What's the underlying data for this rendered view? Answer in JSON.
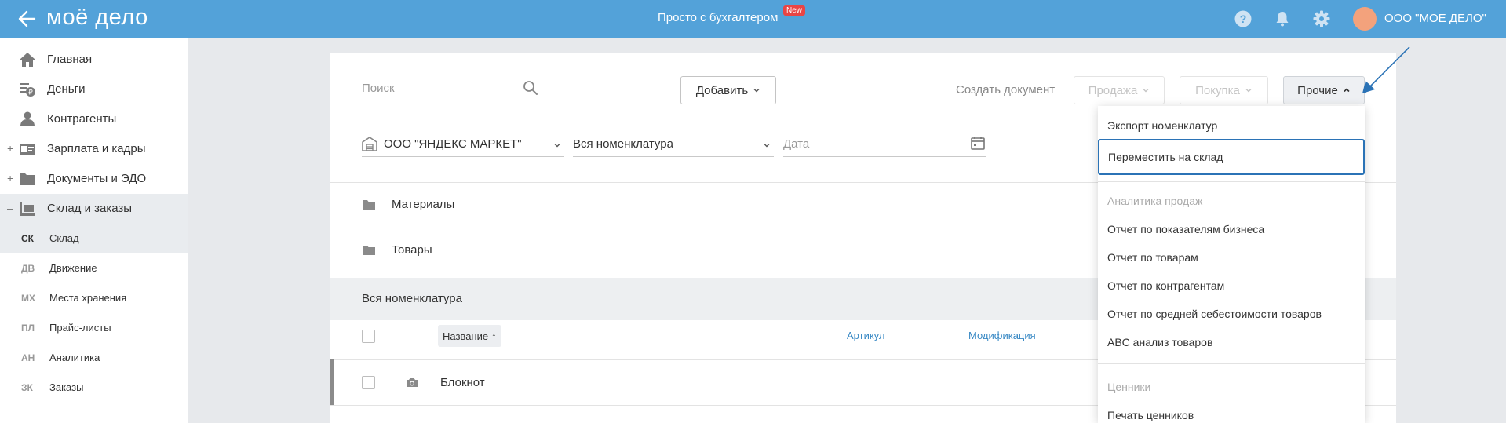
{
  "header": {
    "logo": "моё дело",
    "promo": "Просто с бухгалтером",
    "badge": "New",
    "company": "ООО \"МОЕ ДЕЛО\""
  },
  "sidebar": {
    "items": [
      {
        "label": "Главная"
      },
      {
        "label": "Деньги"
      },
      {
        "label": "Контрагенты"
      },
      {
        "label": "Зарплата и кадры",
        "toggle": "+"
      },
      {
        "label": "Документы и ЭДО",
        "toggle": "+"
      },
      {
        "label": "Склад и заказы",
        "toggle": "–"
      }
    ],
    "subitems": [
      {
        "code": "СК",
        "label": "Склад"
      },
      {
        "code": "ДВ",
        "label": "Движение"
      },
      {
        "code": "МХ",
        "label": "Места хранения"
      },
      {
        "code": "ПЛ",
        "label": "Прайс-листы"
      },
      {
        "code": "АН",
        "label": "Аналитика"
      },
      {
        "code": "ЗК",
        "label": "Заказы"
      }
    ]
  },
  "toolbar": {
    "search_placeholder": "Поиск",
    "add_label": "Добавить",
    "create_doc_label": "Создать документ",
    "sale_label": "Продажа",
    "purchase_label": "Покупка",
    "other_label": "Прочие"
  },
  "filters": {
    "warehouse": "ООО \"ЯНДЕКС МАРКЕТ\"",
    "nomenclature": "Вся номенклатура",
    "date_placeholder": "Дата"
  },
  "folders": [
    {
      "name": "Материалы"
    },
    {
      "name": "Товары"
    }
  ],
  "table": {
    "section_title": "Вся номенклатура",
    "col_name": "Название",
    "col_name_sort": "↑",
    "col_article": "Артикул",
    "col_modification": "Модификация",
    "rows": [
      {
        "name": "Блокнот"
      }
    ]
  },
  "dropdown": {
    "items": [
      {
        "label": "Экспорт номенклатур"
      },
      {
        "label": "Переместить на склад"
      }
    ],
    "analytics_header": "Аналитика продаж",
    "analytics_items": [
      {
        "label": "Отчет по показателям бизнеса"
      },
      {
        "label": "Отчет по товарам"
      },
      {
        "label": "Отчет по контрагентам"
      },
      {
        "label": "Отчет по средней себестоимости товаров"
      },
      {
        "label": "ABC анализ товаров"
      }
    ],
    "price_header": "Ценники",
    "price_items": [
      {
        "label": "Печать ценников"
      }
    ]
  },
  "colors": {
    "header_bg": "#53a2d9",
    "badge": "#e94545",
    "link": "#3a8ac5",
    "highlight_border": "#2b73b6"
  }
}
